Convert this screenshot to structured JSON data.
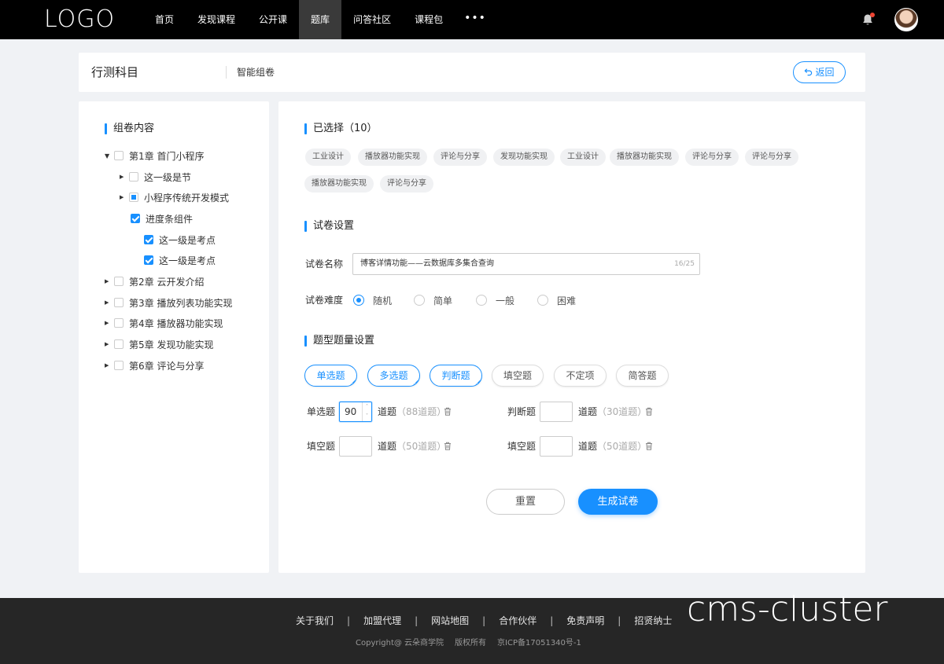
{
  "nav": {
    "logo": "LOGO",
    "items": [
      {
        "label": "首页",
        "active": false
      },
      {
        "label": "发现课程",
        "active": false
      },
      {
        "label": "公开课",
        "active": false
      },
      {
        "label": "题库",
        "active": true
      },
      {
        "label": "问答社区",
        "active": false
      },
      {
        "label": "课程包",
        "active": false
      }
    ],
    "more": "•••",
    "icons": {
      "bell": "bell-icon",
      "avatar": "avatar"
    }
  },
  "header": {
    "title": "行测科目",
    "subtitle": "智能组卷",
    "back_label": "返回"
  },
  "tree": {
    "title": "组卷内容",
    "nodes": [
      {
        "label": "第1章 首门小程序",
        "caret": "down",
        "state": "unchecked"
      },
      {
        "label": "这一级是节",
        "caret": "right",
        "state": "unchecked"
      },
      {
        "label": "小程序传统开发模式",
        "caret": "right",
        "state": "partial"
      },
      {
        "label": "进度条组件",
        "caret": "none",
        "state": "checked"
      },
      {
        "label": "这一级是考点",
        "caret": "none",
        "state": "checked"
      },
      {
        "label": "这一级是考点",
        "caret": "none",
        "state": "checked"
      },
      {
        "label": "第2章 云开发介绍",
        "caret": "right",
        "state": "unchecked"
      },
      {
        "label": "第3章 播放列表功能实现",
        "caret": "right",
        "state": "unchecked"
      },
      {
        "label": "第4章 播放器功能实现",
        "caret": "right",
        "state": "unchecked"
      },
      {
        "label": "第5章 发现功能实现",
        "caret": "right",
        "state": "unchecked"
      },
      {
        "label": "第6章 评论与分享",
        "caret": "right",
        "state": "unchecked"
      }
    ]
  },
  "selected": {
    "title": "已选择（10）",
    "tags": [
      "工业设计",
      "播放器功能实现",
      "评论与分享",
      "发现功能实现",
      "工业设计",
      "播放器功能实现",
      "评论与分享",
      "评论与分享",
      "播放器功能实现",
      "评论与分享"
    ]
  },
  "paper": {
    "title": "试卷设置",
    "name_label": "试卷名称",
    "name_value": "博客详情功能——云数据库多集合查询",
    "name_count": "16/25",
    "difficulty_label": "试卷难度",
    "difficulty_options": [
      {
        "label": "随机",
        "selected": true
      },
      {
        "label": "简单",
        "selected": false
      },
      {
        "label": "一般",
        "selected": false
      },
      {
        "label": "困难",
        "selected": false
      }
    ]
  },
  "qtypes": {
    "title": "题型题量设置",
    "types": [
      {
        "label": "单选题",
        "selected": true
      },
      {
        "label": "多选题",
        "selected": true
      },
      {
        "label": "判断题",
        "selected": true
      },
      {
        "label": "填空题",
        "selected": false
      },
      {
        "label": "不定项",
        "selected": false
      },
      {
        "label": "简答题",
        "selected": false
      }
    ],
    "counts": [
      {
        "label": "单选题",
        "value": "90",
        "unit": "道题",
        "avail": "（88道题）"
      },
      {
        "label": "判断题",
        "value": "",
        "unit": "道题",
        "avail": "（30道题）"
      },
      {
        "label": "填空题",
        "value": "",
        "unit": "道题",
        "avail": "（50道题）"
      },
      {
        "label": "填空题",
        "value": "",
        "unit": "道题",
        "avail": "（50道题）"
      }
    ]
  },
  "actions": {
    "reset": "重置",
    "generate": "生成试卷"
  },
  "footer": {
    "links": [
      "关于我们",
      "加盟代理",
      "网站地图",
      "合作伙伴",
      "免责声明",
      "招贤纳士"
    ],
    "separator": "|",
    "copyright": "Copyright@ 云朵商学院",
    "rights": "版权所有",
    "icp": "京ICP备17051340号-1",
    "watermark": "cms-cluster"
  },
  "colors": {
    "accent": "#1890ff",
    "nav_bg": "#000000",
    "footer_bg": "#262626"
  }
}
